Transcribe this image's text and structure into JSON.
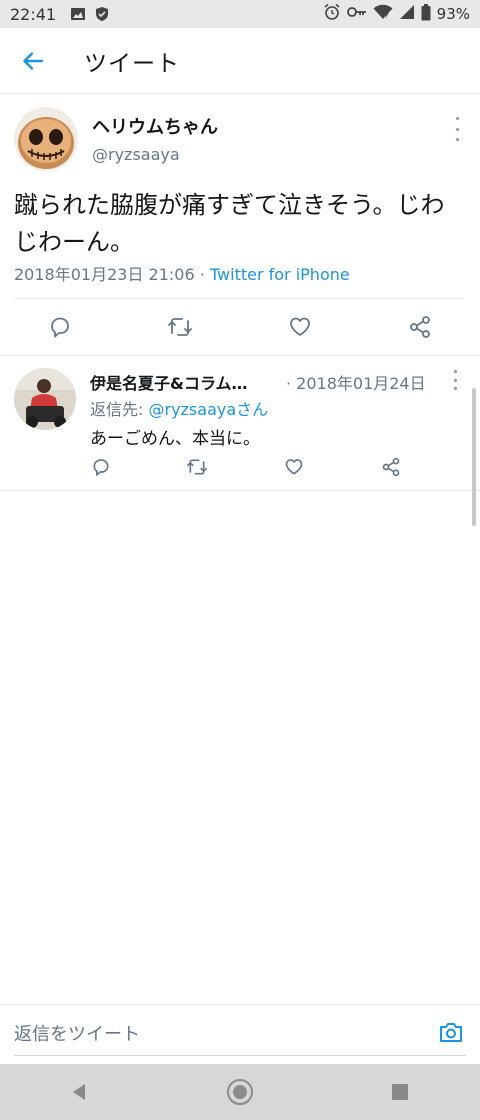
{
  "status_bar": {
    "time": "22:41",
    "battery": "93%"
  },
  "header": {
    "title": "ツイート",
    "back_icon": "arrow-left-icon"
  },
  "tweet": {
    "author_name": "ヘリウムちゃん",
    "author_handle": "@ryzsaaya",
    "text": "蹴られた脇腹が痛すぎて泣きそう。じわじわーん。",
    "date": "2018年01月23日 21:06 · ",
    "source": "Twitter for iPhone",
    "actions": [
      "reply-icon",
      "retweet-icon",
      "like-icon",
      "share-icon"
    ]
  },
  "reply": {
    "author_name": "伊是名夏子&コラム…",
    "date": "· 2018年01月24日",
    "reply_to_label": "返信先: ",
    "reply_to_handle": "@ryzsaayaさん",
    "text": "あーごめん、本当に。"
  },
  "compose": {
    "placeholder": "返信をツイート",
    "camera_icon": "camera-icon"
  },
  "colors": {
    "accent": "#1b95e0",
    "secondary_text": "#657786",
    "icon_gray": "#657786"
  }
}
